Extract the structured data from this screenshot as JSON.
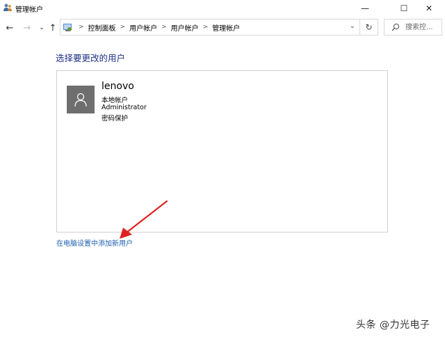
{
  "window": {
    "title": "管理帐户",
    "controls": {
      "minimize": "—",
      "maximize": "☐",
      "close": "✕"
    }
  },
  "nav": {
    "back": "←",
    "forward": "→",
    "recent": "⌄",
    "up": "↑",
    "breadcrumbs": [
      "控制面板",
      "用户帐户",
      "用户帐户",
      "管理帐户"
    ],
    "separator": ">",
    "refresh": "↻",
    "search_placeholder": "搜索控...",
    "dropdown": "⌄"
  },
  "main": {
    "heading": "选择要更改的用户",
    "accounts": [
      {
        "name": "lenovo",
        "type": "本地帐户",
        "role": "Administrator",
        "protection": "密码保护"
      }
    ],
    "add_user_link": "在电脑设置中添加新用户"
  },
  "watermark": "头条 @力光电子",
  "colors": {
    "heading": "#1e3287",
    "link": "#1f5fae",
    "avatar_bg": "#6e6e6e",
    "annotation_arrow": "#e02020"
  }
}
